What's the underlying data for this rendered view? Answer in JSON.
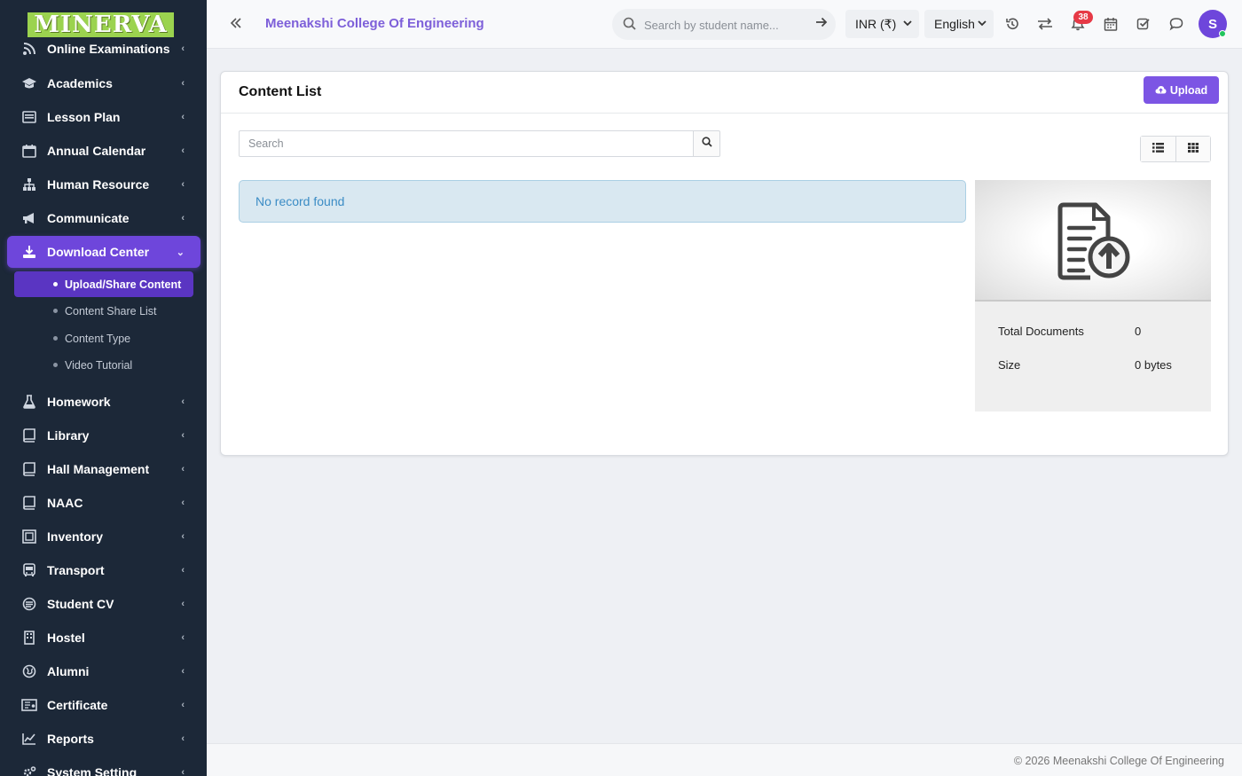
{
  "app": {
    "logo_text": "MINERVA",
    "college_name": "Meenakshi College Of Engineering"
  },
  "sidebar": {
    "items": [
      {
        "label": "Online Examinations",
        "icon": "rss-icon"
      },
      {
        "label": "Academics",
        "icon": "graduation-cap-icon"
      },
      {
        "label": "Lesson Plan",
        "icon": "list-board-icon"
      },
      {
        "label": "Annual Calendar",
        "icon": "calendar-icon"
      },
      {
        "label": "Human Resource",
        "icon": "sitemap-icon"
      },
      {
        "label": "Communicate",
        "icon": "bullhorn-icon"
      },
      {
        "label": "Download Center",
        "icon": "download-icon"
      },
      {
        "label": "Homework",
        "icon": "flask-icon"
      },
      {
        "label": "Library",
        "icon": "book-icon"
      },
      {
        "label": "Hall Management",
        "icon": "book-icon"
      },
      {
        "label": "NAAC",
        "icon": "book-icon"
      },
      {
        "label": "Inventory",
        "icon": "inventory-icon"
      },
      {
        "label": "Transport",
        "icon": "bus-icon"
      },
      {
        "label": "Student CV",
        "icon": "cv-icon"
      },
      {
        "label": "Hostel",
        "icon": "building-icon"
      },
      {
        "label": "Alumni",
        "icon": "globe-icon"
      },
      {
        "label": "Certificate",
        "icon": "certificate-icon"
      },
      {
        "label": "Reports",
        "icon": "line-chart-icon"
      },
      {
        "label": "System Setting",
        "icon": "gears-icon"
      }
    ],
    "download_center_sub": [
      {
        "label": "Upload/Share Content"
      },
      {
        "label": "Content Share List"
      },
      {
        "label": "Content Type"
      },
      {
        "label": "Video Tutorial"
      }
    ]
  },
  "topbar": {
    "search_placeholder": "Search by student name...",
    "currency": "INR (₹)",
    "language": "English",
    "notification_count": "38",
    "avatar_initial": "S"
  },
  "content": {
    "title": "Content List",
    "upload_label": "Upload",
    "search_placeholder": "Search",
    "empty_message": "No record found",
    "stats": {
      "total_documents_label": "Total Documents",
      "total_documents_value": "0",
      "size_label": "Size",
      "size_value": "0 bytes"
    }
  },
  "footer": {
    "copyright": "© 2026 Meenakshi College Of Engineering"
  },
  "colors": {
    "accent": "#6e46db",
    "sidebar_bg": "#1c2838",
    "alert_bg": "#d9e8f1",
    "alert_text": "#3b8cc5",
    "badge": "#e63946"
  }
}
